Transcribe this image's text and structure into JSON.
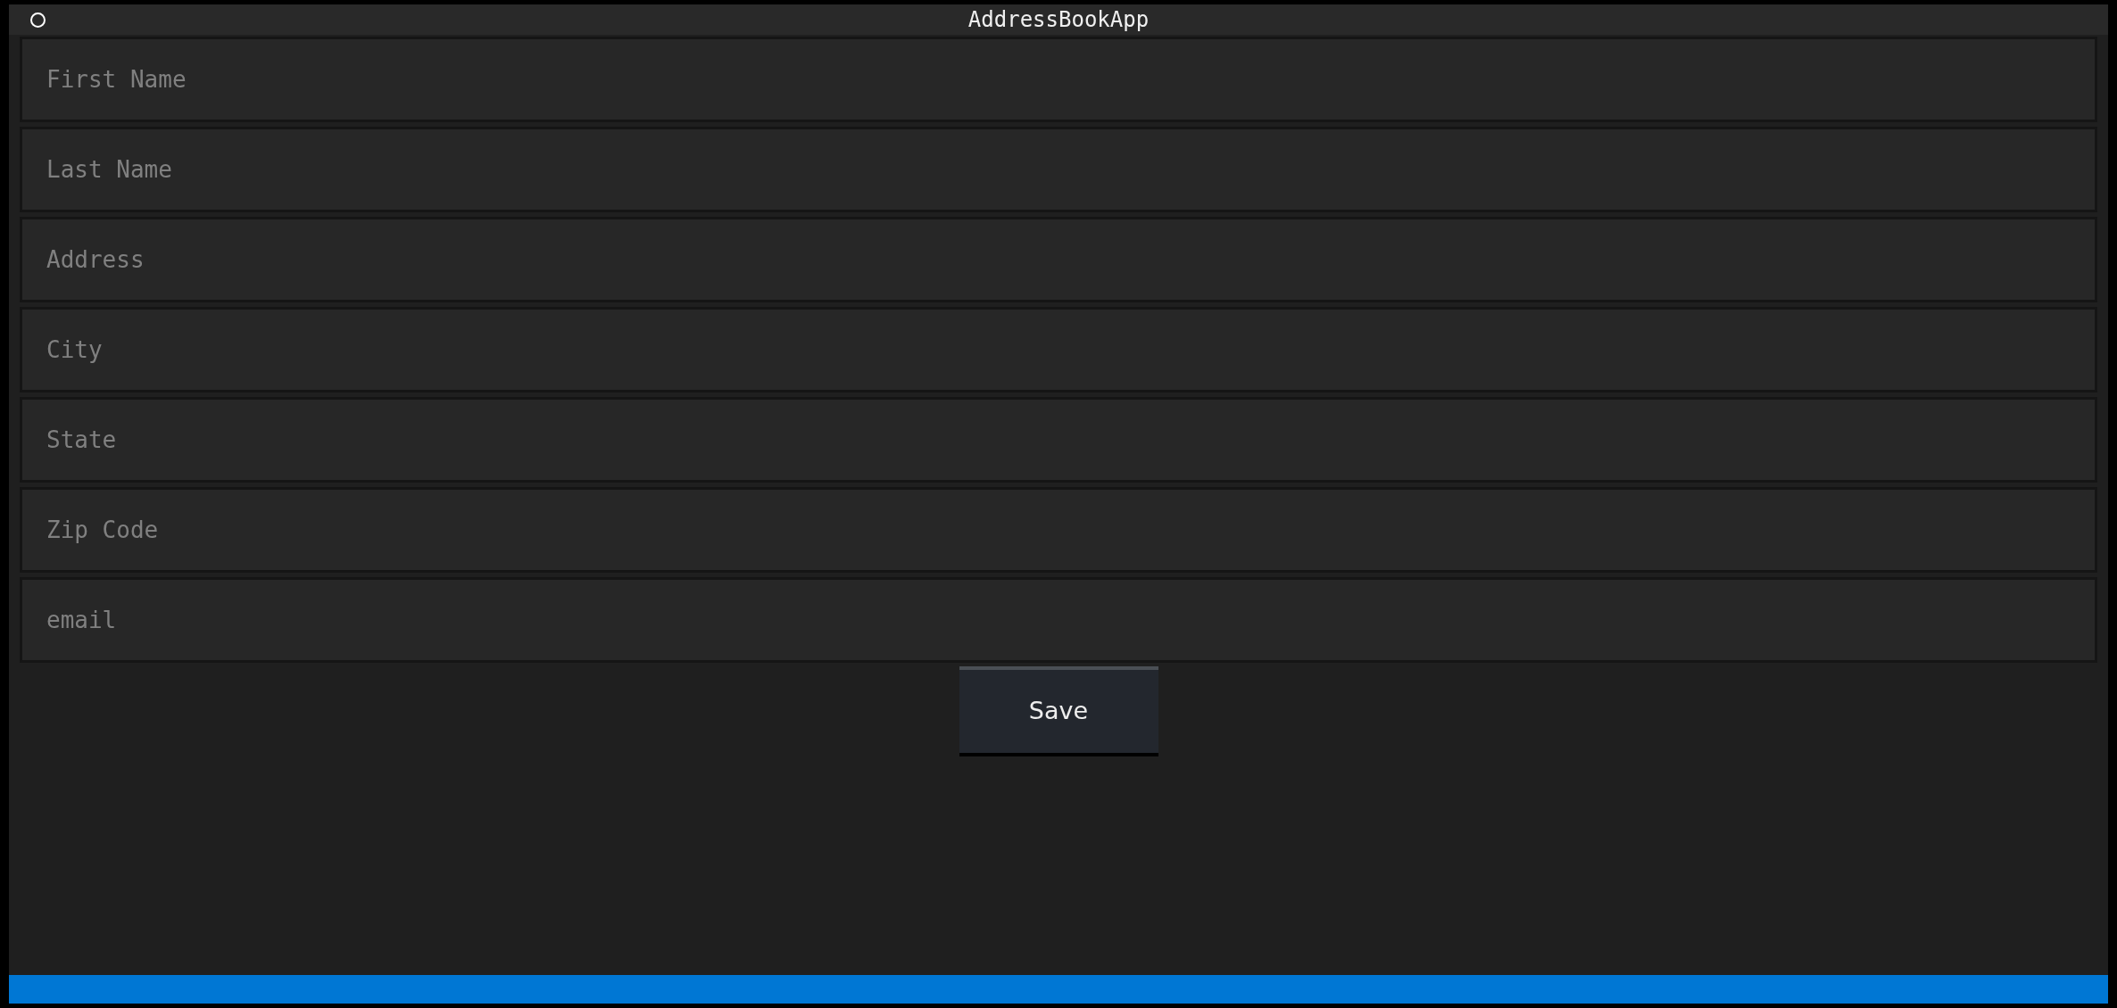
{
  "window": {
    "title": "AddressBookApp"
  },
  "fields": [
    {
      "placeholder": "First Name"
    },
    {
      "placeholder": "Last Name"
    },
    {
      "placeholder": "Address"
    },
    {
      "placeholder": "City"
    },
    {
      "placeholder": "State"
    },
    {
      "placeholder": "Zip Code"
    },
    {
      "placeholder": "email"
    }
  ],
  "buttons": [
    {
      "label": "Save"
    }
  ]
}
